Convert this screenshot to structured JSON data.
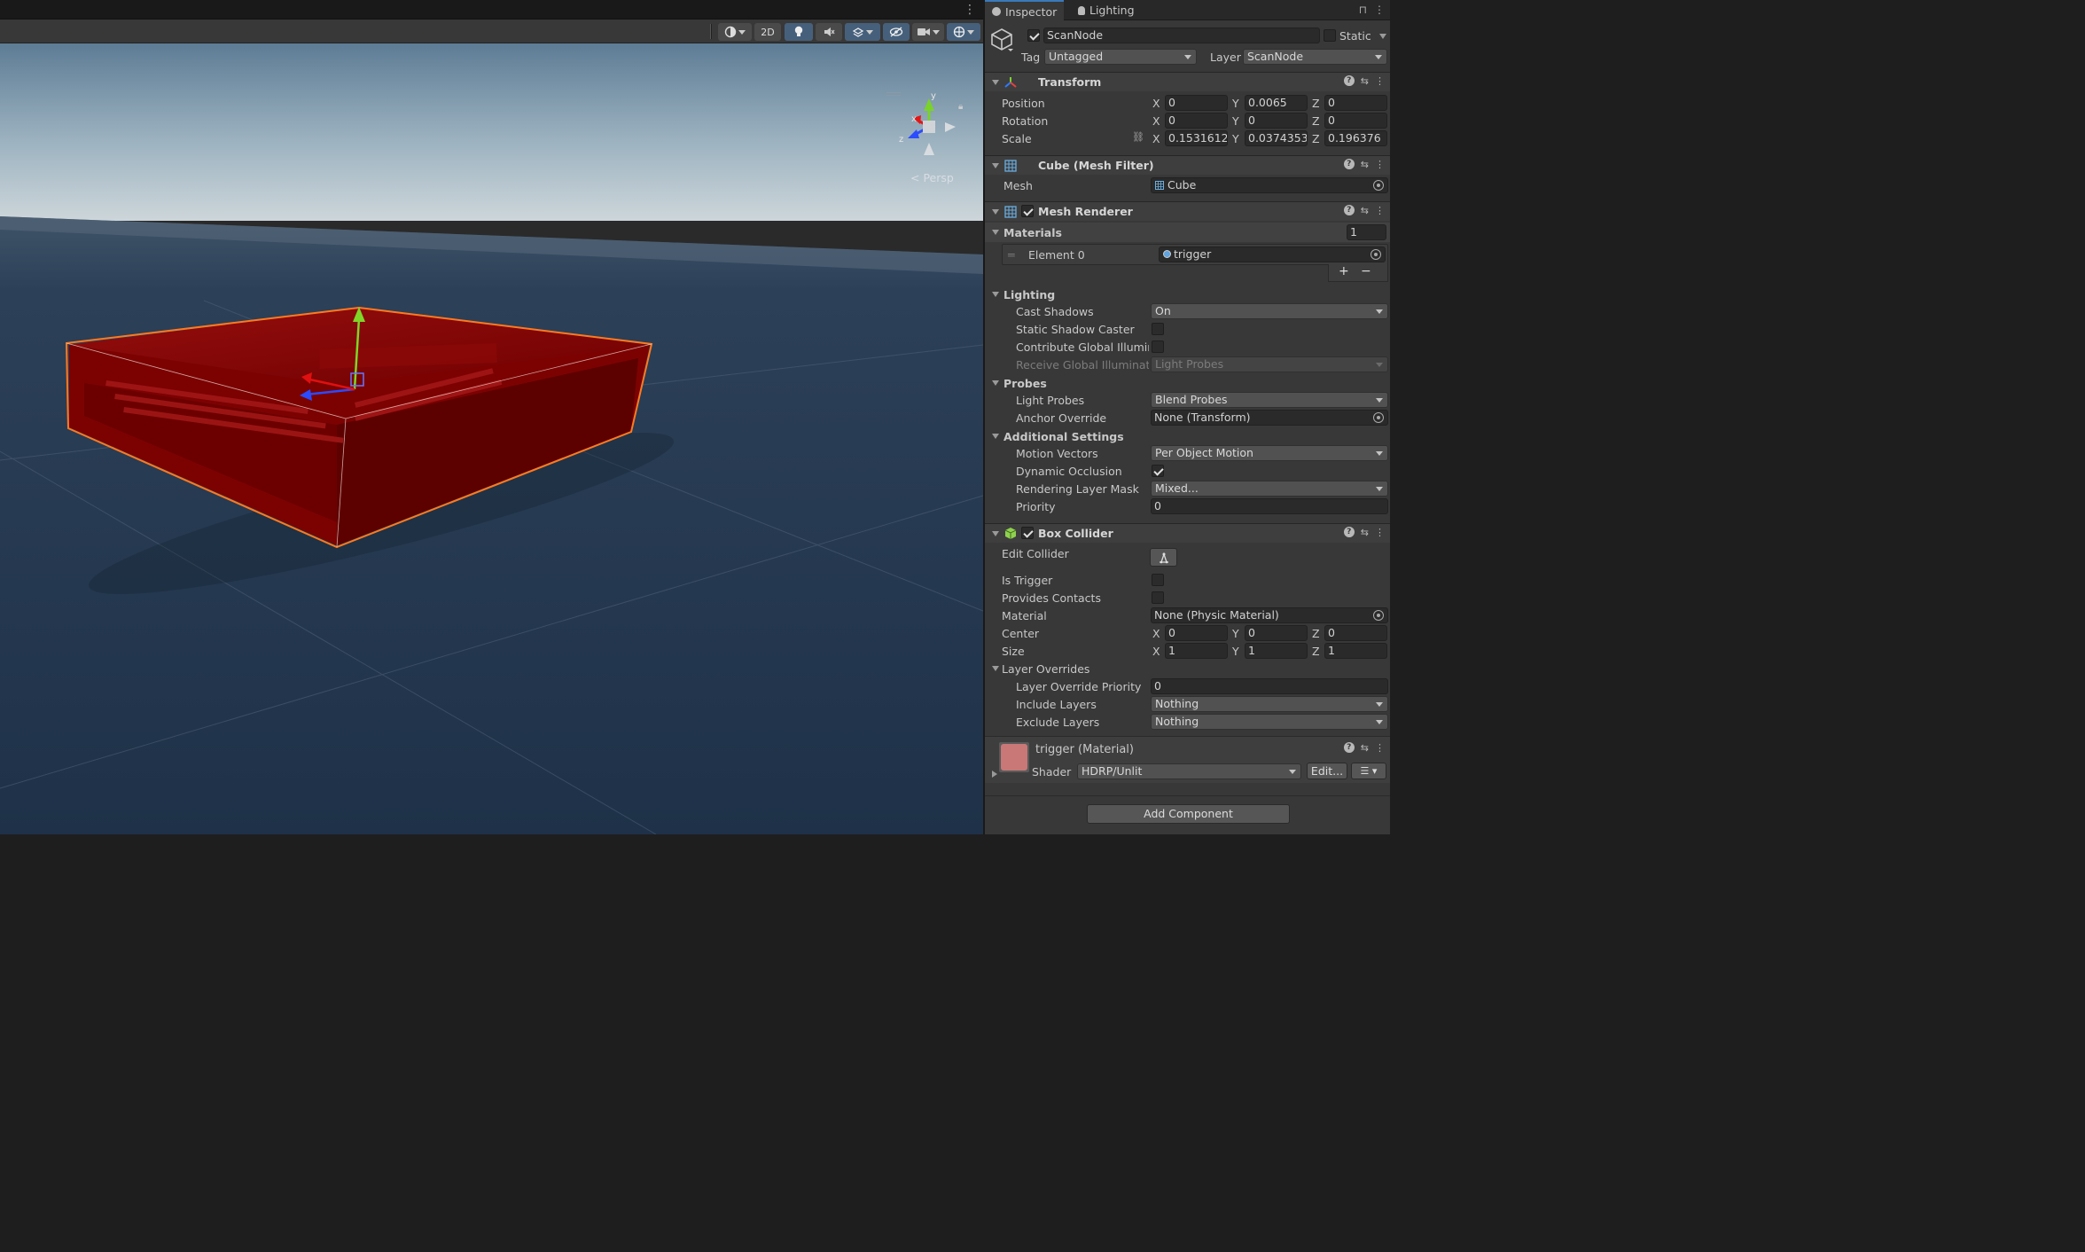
{
  "scene": {
    "toolbar": {
      "view_2d_label": "2D"
    },
    "gizmo": {
      "y_label": "y",
      "x_label": "x",
      "z_label": "z",
      "persp_label": "< Persp"
    },
    "colors": {
      "sky_top": "#5d7c95",
      "horizon": "#c8d2d8",
      "ground": "#22354c",
      "selection_outline": "#ff7a1f",
      "object_red": "#8b0000"
    }
  },
  "inspector": {
    "tabs": [
      {
        "label": "Inspector",
        "icon": "info-icon"
      },
      {
        "label": "Lighting",
        "icon": "lightbulb-icon"
      }
    ],
    "object": {
      "name": "ScanNode",
      "active": true,
      "static_label": "Static",
      "static": false,
      "tag_label": "Tag",
      "tag_value": "Untagged",
      "layer_label": "Layer",
      "layer_value": "ScanNode"
    },
    "transform": {
      "title": "Transform",
      "position_label": "Position",
      "rotation_label": "Rotation",
      "scale_label": "Scale",
      "position": {
        "x": "0",
        "y": "0.0065",
        "z": "0"
      },
      "rotation": {
        "x": "0",
        "y": "0",
        "z": "0"
      },
      "scale": {
        "x": "0.1531612",
        "y": "0.0374353",
        "z": "0.196376"
      }
    },
    "mesh_filter": {
      "title": "Cube (Mesh Filter)",
      "mesh_label": "Mesh",
      "mesh_value": "Cube"
    },
    "mesh_renderer": {
      "title": "Mesh Renderer",
      "enabled": true,
      "materials_label": "Materials",
      "materials_count": "1",
      "element0_label": "Element 0",
      "element0_value": "trigger",
      "lighting_label": "Lighting",
      "cast_shadows_label": "Cast Shadows",
      "cast_shadows_value": "On",
      "static_shadow_caster_label": "Static Shadow Caster",
      "contribute_gi_label": "Contribute Global Illumina",
      "receive_gi_label": "Receive Global Illuminatic",
      "receive_gi_value": "Light Probes",
      "probes_label": "Probes",
      "light_probes_label": "Light Probes",
      "light_probes_value": "Blend Probes",
      "anchor_override_label": "Anchor Override",
      "anchor_override_value": "None (Transform)",
      "additional_settings_label": "Additional Settings",
      "motion_vectors_label": "Motion Vectors",
      "motion_vectors_value": "Per Object Motion",
      "dynamic_occlusion_label": "Dynamic Occlusion",
      "dynamic_occlusion": true,
      "rendering_layer_mask_label": "Rendering Layer Mask",
      "rendering_layer_mask_value": "Mixed...",
      "priority_label": "Priority",
      "priority_value": "0",
      "add_label": "+",
      "remove_label": "−"
    },
    "box_collider": {
      "title": "Box Collider",
      "enabled": true,
      "edit_collider_label": "Edit Collider",
      "is_trigger_label": "Is Trigger",
      "is_trigger": false,
      "provides_contacts_label": "Provides Contacts",
      "provides_contacts": false,
      "material_label": "Material",
      "material_value": "None (Physic Material)",
      "center_label": "Center",
      "center": {
        "x": "0",
        "y": "0",
        "z": "0"
      },
      "size_label": "Size",
      "size": {
        "x": "1",
        "y": "1",
        "z": "1"
      },
      "layer_overrides_label": "Layer Overrides",
      "layer_override_priority_label": "Layer Override Priority",
      "layer_override_priority_value": "0",
      "include_layers_label": "Include Layers",
      "include_layers_value": "Nothing",
      "exclude_layers_label": "Exclude Layers",
      "exclude_layers_value": "Nothing"
    },
    "material": {
      "title": "trigger (Material)",
      "shader_label": "Shader",
      "shader_value": "HDRP/Unlit",
      "edit_label": "Edit...",
      "swatch_color": "#c97777"
    },
    "add_component_label": "Add Component",
    "axis_labels": {
      "x": "X",
      "y": "Y",
      "z": "Z"
    }
  }
}
